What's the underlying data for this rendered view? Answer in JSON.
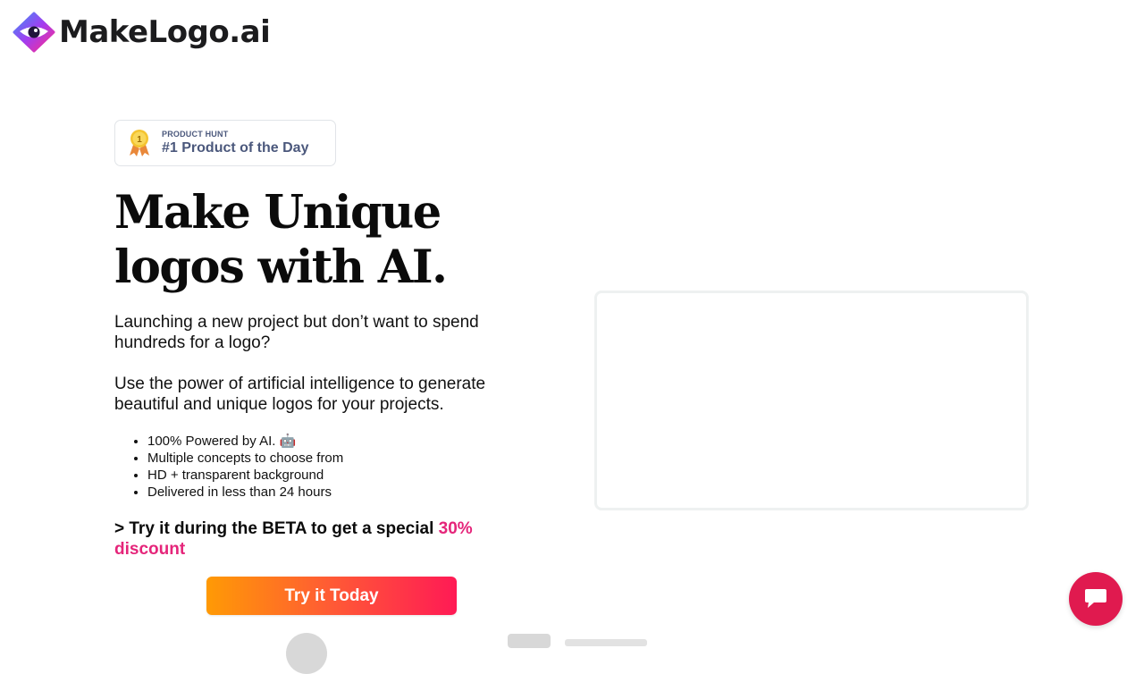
{
  "brand": {
    "name": "MakeLogo.ai",
    "colors": {
      "gradient_start": "#ff9a05",
      "gradient_end": "#ff1a55",
      "accent": "#e5257a",
      "chat": "#e01a4f"
    }
  },
  "badge": {
    "kicker": "PRODUCT HUNT",
    "title": "#1 Product of the Day",
    "medal_number": "1"
  },
  "hero": {
    "headline": "Make Unique logos with AI.",
    "paragraph_1": "Launching a new project but don’t want to spend hundreds for a logo?",
    "paragraph_2": "Use the power of artificial intelligence to generate beautiful and unique logos for your projects.",
    "features": [
      "100% Powered by AI. 🤖",
      "Multiple concepts to choose from",
      "HD + transparent background",
      "Delivered in less than 24 hours"
    ],
    "beta_prefix": "> Try it during the BETA to get a special ",
    "beta_discount": "30% discount",
    "cta_label": "Try it Today"
  },
  "icons": {
    "logo": "eye-logo-icon",
    "medal": "medal-icon",
    "chat": "chat-bubble-icon"
  }
}
